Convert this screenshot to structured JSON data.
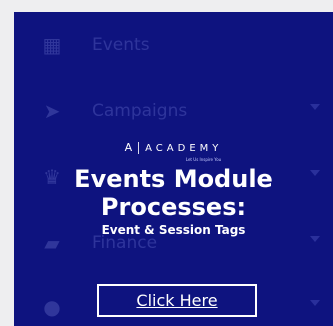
{
  "ghost_menu": {
    "items": [
      {
        "label": "Events",
        "icon": "calendar-icon"
      },
      {
        "label": "Campaigns",
        "icon": "send-icon"
      },
      {
        "label": "",
        "icon": "crown-icon"
      },
      {
        "label": "Finance",
        "icon": "wallet-icon"
      },
      {
        "label": "",
        "icon": "users-icon"
      }
    ]
  },
  "banner": {
    "brand_mark": "A",
    "brand_word": "ACADEMY",
    "tagline": "Let Us Inspire You",
    "headline_line1": "Events Module",
    "headline_line2": "Processes:",
    "subheadline": "Event & Session Tags",
    "cta_label": "Click Here"
  },
  "colors": {
    "background": "#eeeef0",
    "banner_bg": "#0e137f",
    "text": "#ffffff"
  }
}
